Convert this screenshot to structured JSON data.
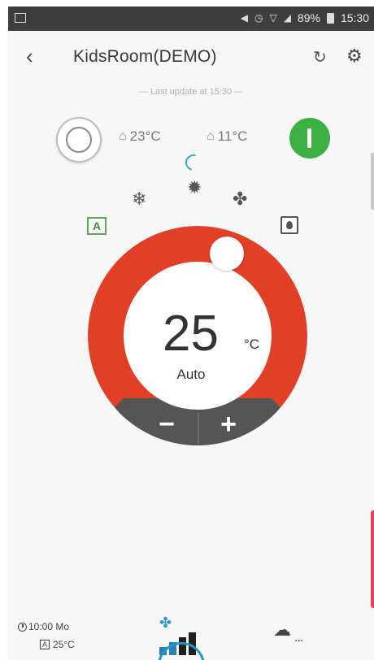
{
  "status_bar": {
    "battery": "89%",
    "time": "15:30",
    "icons": [
      "gallery-icon",
      "mute-icon",
      "alarm-icon",
      "wifi-icon",
      "signal-icon",
      "battery-icon"
    ]
  },
  "toolbar": {
    "back_icon": "chevron-left-icon",
    "title": "KidsRoom(DEMO)",
    "refresh_icon": "refresh-icon",
    "settings_icon": "gear-icon"
  },
  "last_update": "— Last update at 15:30 —",
  "indoor_temp": "23°C",
  "outdoor_temp": "11°C",
  "power": {
    "state": "on",
    "color": "#3cb043"
  },
  "modes": [
    "auto",
    "cool",
    "heat",
    "fan",
    "dry"
  ],
  "active_mode_color": "#e14026",
  "setpoint": {
    "value": "25",
    "unit": "°C",
    "mode_label": "Auto",
    "minus": "−",
    "plus": "+"
  },
  "bottom": {
    "timer_time": "10:00 Mo",
    "timer_temp": "25°C",
    "timer_mode": "A",
    "preset_more": "..."
  },
  "colors": {
    "dial_red": "#e14026",
    "dial_grey": "#555555",
    "accent_blue": "#2d7fb3",
    "spinner": "#35a9c4"
  }
}
